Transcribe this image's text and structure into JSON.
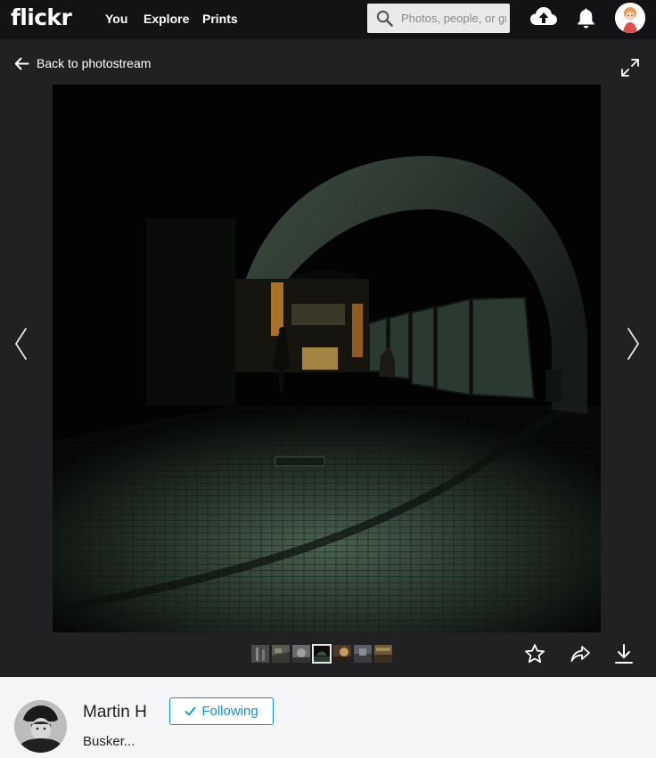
{
  "header": {
    "logo": "flickr",
    "nav": {
      "you": "You",
      "explore": "Explore",
      "prints": "Prints"
    },
    "search": {
      "placeholder": "Photos, people, or groups"
    },
    "icons": [
      "search-icon",
      "upload-cloud-icon",
      "bell-icon",
      "avatar"
    ]
  },
  "photo_view": {
    "back_label": "Back to photostream",
    "thumbnails_count": 7,
    "active_thumbnail": 4,
    "actions": [
      "favorite-star-icon",
      "share-arrow-icon",
      "download-icon"
    ]
  },
  "owner": {
    "name": "Martin H",
    "follow_label": "Following",
    "photo_title": "Busker..."
  },
  "colors": {
    "topbar": "#131315",
    "background": "#212124",
    "owner_panel": "#f3f5f6",
    "accent_blue": "#128fdc"
  }
}
